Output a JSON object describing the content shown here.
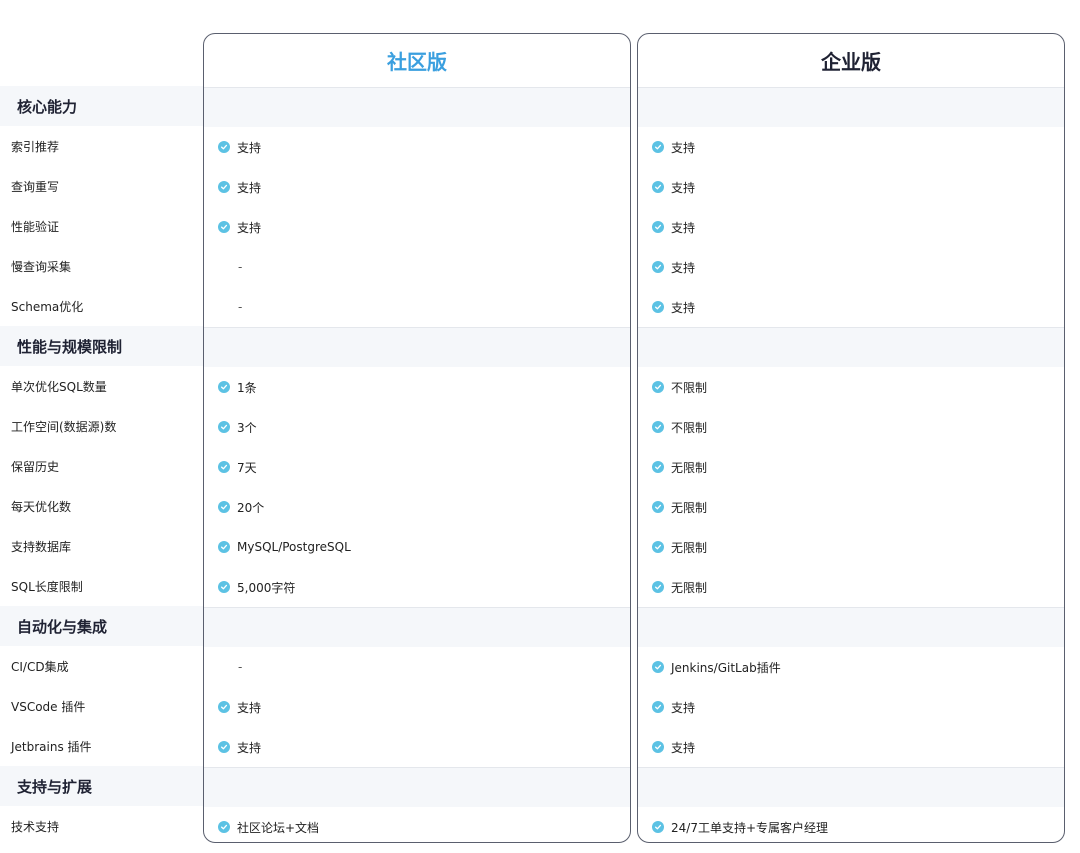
{
  "columns": {
    "community": {
      "title": "社区版"
    },
    "enterprise": {
      "title": "企业版"
    }
  },
  "colors": {
    "accent": "#3a9fdf",
    "check": "#5cc2e4",
    "section_bg": "#f5f7fa",
    "heading": "#1f2233"
  },
  "icons": {
    "supported": "check-circle-icon"
  },
  "sections": [
    {
      "title": "核心能力",
      "rows": [
        {
          "label": "索引推荐",
          "community": {
            "text": "支持",
            "check": true
          },
          "enterprise": {
            "text": "支持",
            "check": true
          }
        },
        {
          "label": "查询重写",
          "community": {
            "text": "支持",
            "check": true
          },
          "enterprise": {
            "text": "支持",
            "check": true
          }
        },
        {
          "label": "性能验证",
          "community": {
            "text": "支持",
            "check": true
          },
          "enterprise": {
            "text": "支持",
            "check": true
          }
        },
        {
          "label": "慢查询采集",
          "community": {
            "text": "-",
            "check": false
          },
          "enterprise": {
            "text": "支持",
            "check": true
          }
        },
        {
          "label": "Schema优化",
          "community": {
            "text": "-",
            "check": false
          },
          "enterprise": {
            "text": "支持",
            "check": true
          }
        }
      ]
    },
    {
      "title": "性能与规模限制",
      "rows": [
        {
          "label": "单次优化SQL数量",
          "community": {
            "text": "1条",
            "check": true
          },
          "enterprise": {
            "text": "不限制",
            "check": true
          }
        },
        {
          "label": "工作空间(数据源)数",
          "community": {
            "text": "3个",
            "check": true
          },
          "enterprise": {
            "text": "不限制",
            "check": true
          }
        },
        {
          "label": "保留历史",
          "community": {
            "text": "7天",
            "check": true
          },
          "enterprise": {
            "text": "无限制",
            "check": true
          }
        },
        {
          "label": "每天优化数",
          "community": {
            "text": "20个",
            "check": true
          },
          "enterprise": {
            "text": "无限制",
            "check": true
          }
        },
        {
          "label": "支持数据库",
          "community": {
            "text": "MySQL/PostgreSQL",
            "check": true
          },
          "enterprise": {
            "text": "无限制",
            "check": true
          }
        },
        {
          "label": "SQL长度限制",
          "community": {
            "text": "5,000字符",
            "check": true
          },
          "enterprise": {
            "text": "无限制",
            "check": true
          }
        }
      ]
    },
    {
      "title": "自动化与集成",
      "rows": [
        {
          "label": "CI/CD集成",
          "community": {
            "text": "-",
            "check": false
          },
          "enterprise": {
            "text": "Jenkins/GitLab插件",
            "check": true
          }
        },
        {
          "label": "VSCode 插件",
          "community": {
            "text": "支持",
            "check": true
          },
          "enterprise": {
            "text": "支持",
            "check": true
          }
        },
        {
          "label": "Jetbrains 插件",
          "community": {
            "text": "支持",
            "check": true
          },
          "enterprise": {
            "text": "支持",
            "check": true
          }
        }
      ]
    },
    {
      "title": "支持与扩展",
      "rows": [
        {
          "label": "技术支持",
          "community": {
            "text": "社区论坛+文档",
            "check": true
          },
          "enterprise": {
            "text": "24/7工单支持+专属客户经理",
            "check": true
          }
        }
      ]
    }
  ]
}
